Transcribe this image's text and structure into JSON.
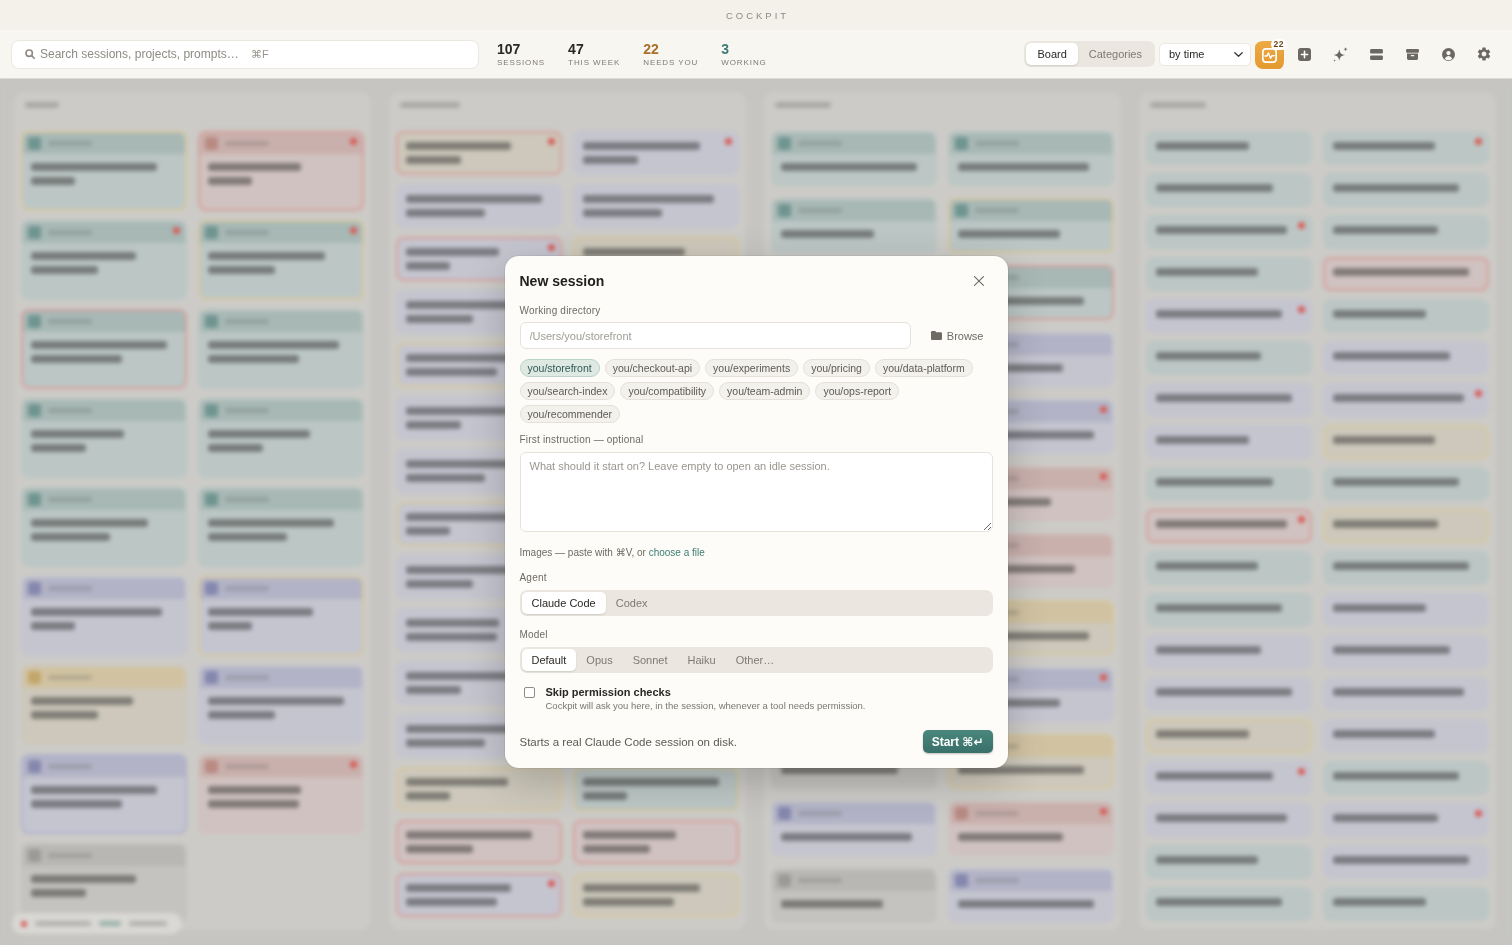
{
  "window": {
    "title": "COCKPIT"
  },
  "toolbar": {
    "search": {
      "placeholder": "Search sessions, projects, prompts…",
      "shortcut": "⌘F"
    },
    "stats": [
      {
        "value": "107",
        "label": "SESSIONS",
        "kind": "total"
      },
      {
        "value": "47",
        "label": "THIS WEEK",
        "kind": "total"
      },
      {
        "value": "22",
        "label": "NEEDS YOU",
        "kind": "attention"
      },
      {
        "value": "3",
        "label": "WORKING",
        "kind": "active"
      }
    ],
    "view_tabs": [
      {
        "label": "Board",
        "selected": true
      },
      {
        "label": "Categories",
        "selected": false
      }
    ],
    "sort": {
      "value": "by time"
    },
    "activity": {
      "badge": "22"
    }
  },
  "dialog": {
    "title": "New session",
    "directory": {
      "label": "Working directory",
      "placeholder": "/Users/you/storefront",
      "browse": "Browse"
    },
    "projects": [
      {
        "label": "you/storefront",
        "selected": true
      },
      {
        "label": "you/checkout-api",
        "selected": false
      },
      {
        "label": "you/experiments",
        "selected": false
      },
      {
        "label": "you/pricing",
        "selected": false
      },
      {
        "label": "you/data-platform",
        "selected": false
      },
      {
        "label": "you/search-index",
        "selected": false
      },
      {
        "label": "you/compatibility",
        "selected": false
      },
      {
        "label": "you/team-admin",
        "selected": false
      },
      {
        "label": "you/ops-report",
        "selected": false
      },
      {
        "label": "you/recommender",
        "selected": false
      }
    ],
    "instruction": {
      "label": "First instruction — optional",
      "placeholder": "What should it start on? Leave empty to open an idle session."
    },
    "images": {
      "text": "Images — paste with ⌘V, or",
      "link": "choose a file"
    },
    "agent": {
      "label": "Agent",
      "options": [
        {
          "label": "Claude Code",
          "selected": true
        },
        {
          "label": "Codex",
          "selected": false
        }
      ]
    },
    "model": {
      "label": "Model",
      "options": [
        {
          "label": "Default",
          "selected": true
        },
        {
          "label": "Opus",
          "selected": false
        },
        {
          "label": "Sonnet",
          "selected": false
        },
        {
          "label": "Haiku",
          "selected": false
        },
        {
          "label": "Other…",
          "selected": false
        }
      ]
    },
    "skip_permissions": {
      "label": "Skip permission checks",
      "description": "Cockpit will ask you here, in the session, whenever a tool needs permission.",
      "checked": false
    },
    "footer_note": "Starts a real Claude Code session on disk.",
    "start_button": "Start ⌘↵"
  }
}
